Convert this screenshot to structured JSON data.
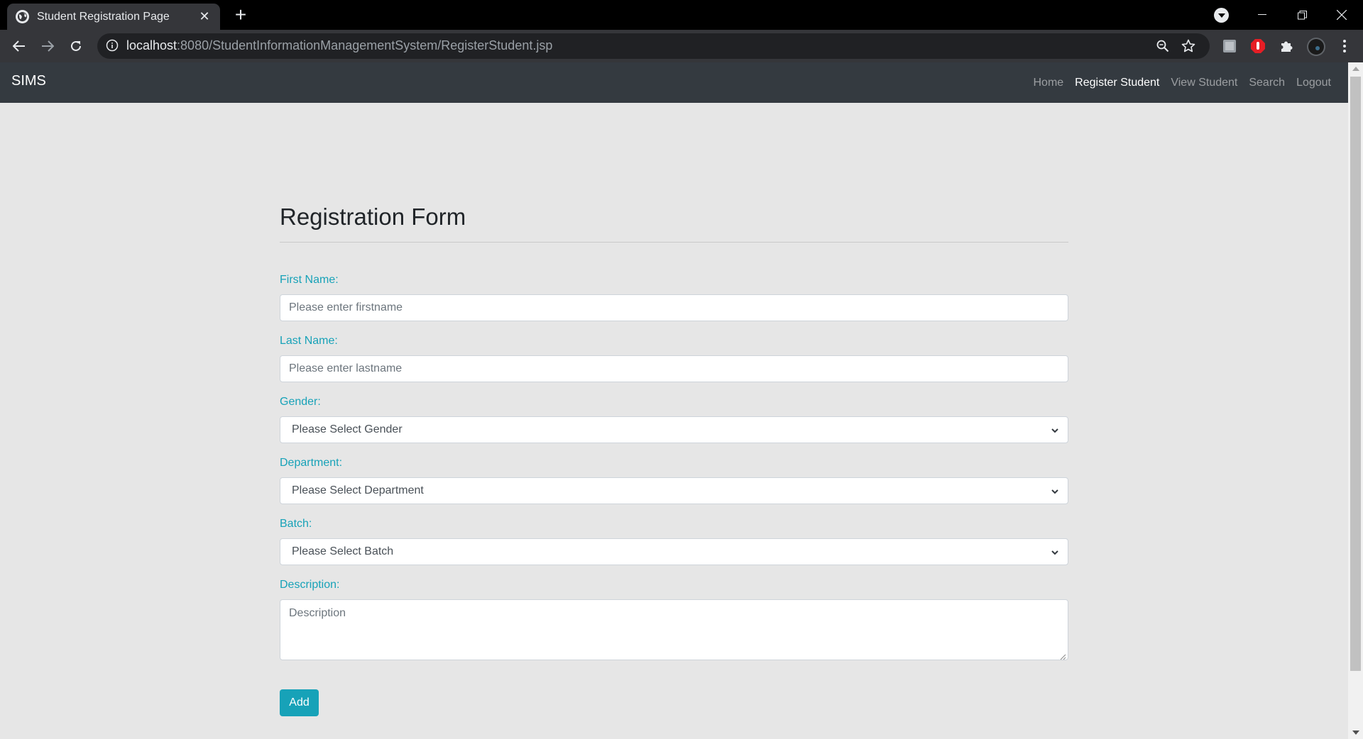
{
  "browser": {
    "tab_title": "Student Registration Page",
    "url_host": "localhost",
    "url_rest": ":8080/StudentInformationManagementSystem/RegisterStudent.jsp"
  },
  "navbar": {
    "brand": "SIMS",
    "links": [
      {
        "label": "Home",
        "active": false
      },
      {
        "label": "Register Student",
        "active": true
      },
      {
        "label": "View Student",
        "active": false
      },
      {
        "label": "Search",
        "active": false
      },
      {
        "label": "Logout",
        "active": false
      }
    ]
  },
  "form": {
    "title": "Registration Form",
    "first_name": {
      "label": "First Name:",
      "placeholder": "Please enter firstname"
    },
    "last_name": {
      "label": "Last Name:",
      "placeholder": "Please enter lastname"
    },
    "gender": {
      "label": "Gender:",
      "selected": "Please Select Gender"
    },
    "department": {
      "label": "Department:",
      "selected": "Please Select Department"
    },
    "batch": {
      "label": "Batch:",
      "selected": "Please Select Batch"
    },
    "description": {
      "label": "Description:",
      "placeholder": "Description"
    },
    "submit_label": "Add"
  },
  "colors": {
    "navbar_bg": "#343a40",
    "accent": "#17a2b8",
    "page_bg": "#e6e6e6"
  },
  "icons": [
    "globe-icon",
    "close-icon",
    "plus-icon",
    "back-icon",
    "forward-icon",
    "reload-icon",
    "info-icon",
    "zoom-icon",
    "star-icon",
    "extension-icon",
    "puzzle-icon",
    "avatar",
    "menu-icon",
    "chevron-down-icon"
  ]
}
